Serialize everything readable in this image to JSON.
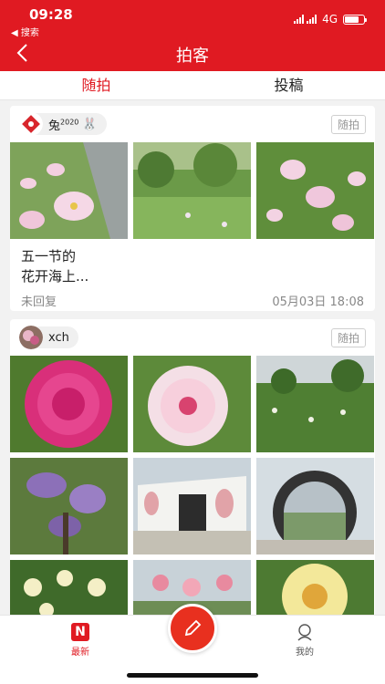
{
  "status": {
    "time": "09:28",
    "back_app": "◀ 搜索",
    "network": "4G",
    "battery_level": 0.75
  },
  "nav": {
    "title": "拍客",
    "back_icon": "chevron-left-icon"
  },
  "tabs": [
    {
      "label": "随拍",
      "active": true
    },
    {
      "label": "投稿",
      "active": false
    }
  ],
  "posts": [
    {
      "user": "兔",
      "user_sup": "2020",
      "user_badge": "🐰",
      "tag": "随拍",
      "text_line1": "五一节的",
      "text_line2": "花开海上...",
      "reply_status": "未回复",
      "date": "05月03日 18:08",
      "photos": [
        "flower-photo",
        "garden-photo",
        "flower-photo"
      ]
    },
    {
      "user": "xch",
      "tag": "随拍",
      "photos": [
        "peony-photo",
        "peony-photo",
        "garden-photo",
        "wisteria-photo",
        "building-photo",
        "gate-photo",
        "flowers-photo",
        "lanterns-photo",
        "peony-photo"
      ]
    }
  ],
  "bottom_nav": {
    "latest_label": "最新",
    "mine_label": "我的",
    "fab_icon": "pen-icon"
  },
  "colors": {
    "brand": "#e01a22"
  }
}
